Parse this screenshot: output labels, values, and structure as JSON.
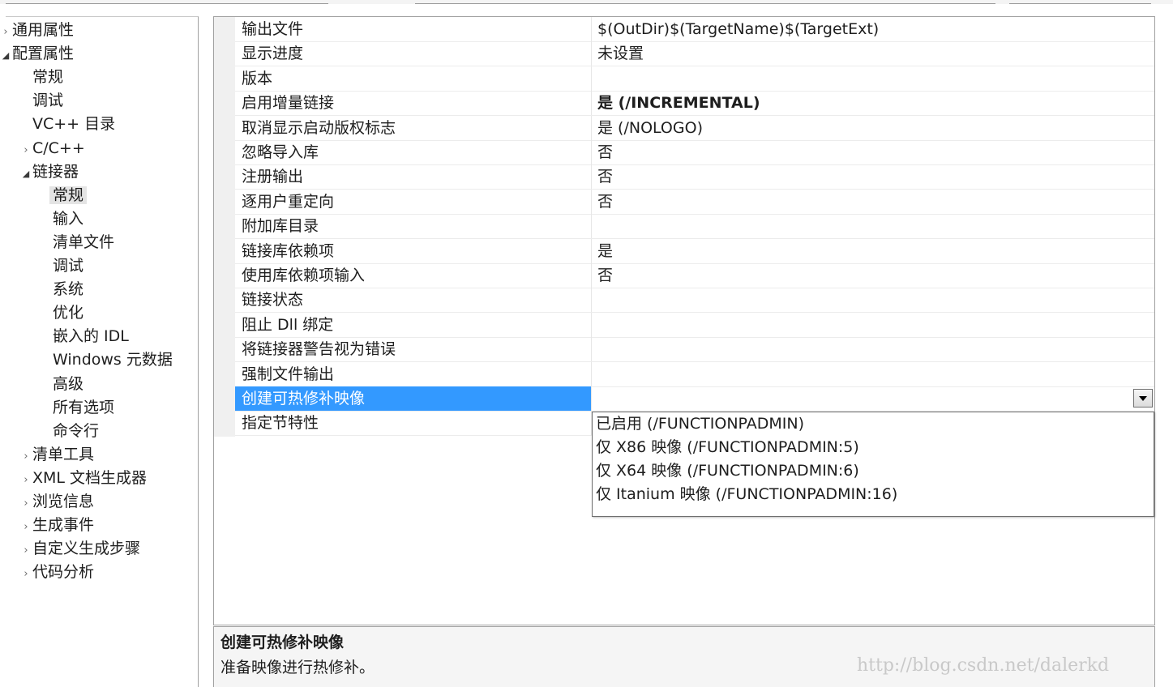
{
  "tree": {
    "items": [
      {
        "label": "通用属性",
        "arrow": "›",
        "level": 0
      },
      {
        "label": "配置属性",
        "arrow": "◢",
        "level": 0
      },
      {
        "label": "常规",
        "arrow": "",
        "level": 1
      },
      {
        "label": "调试",
        "arrow": "",
        "level": 1
      },
      {
        "label": "VC++ 目录",
        "arrow": "",
        "level": 1
      },
      {
        "label": "C/C++",
        "arrow": "›",
        "level": 1
      },
      {
        "label": "链接器",
        "arrow": "◢",
        "level": 1
      },
      {
        "label": "常规",
        "arrow": "",
        "level": 2
      },
      {
        "label": "输入",
        "arrow": "",
        "level": 2
      },
      {
        "label": "清单文件",
        "arrow": "",
        "level": 2
      },
      {
        "label": "调试",
        "arrow": "",
        "level": 2
      },
      {
        "label": "系统",
        "arrow": "",
        "level": 2
      },
      {
        "label": "优化",
        "arrow": "",
        "level": 2
      },
      {
        "label": "嵌入的 IDL",
        "arrow": "",
        "level": 2
      },
      {
        "label": "Windows 元数据",
        "arrow": "",
        "level": 2
      },
      {
        "label": "高级",
        "arrow": "",
        "level": 2
      },
      {
        "label": "所有选项",
        "arrow": "",
        "level": 2
      },
      {
        "label": "命令行",
        "arrow": "",
        "level": 2
      },
      {
        "label": "清单工具",
        "arrow": "›",
        "level": 1
      },
      {
        "label": "XML 文档生成器",
        "arrow": "›",
        "level": 1
      },
      {
        "label": "浏览信息",
        "arrow": "›",
        "level": 1
      },
      {
        "label": "生成事件",
        "arrow": "›",
        "level": 1
      },
      {
        "label": "自定义生成步骤",
        "arrow": "›",
        "level": 1
      },
      {
        "label": "代码分析",
        "arrow": "›",
        "level": 1
      }
    ]
  },
  "grid": {
    "rows": [
      {
        "name": "输出文件",
        "value": "$(OutDir)$(TargetName)$(TargetExt)"
      },
      {
        "name": "显示进度",
        "value": "未设置"
      },
      {
        "name": "版本",
        "value": ""
      },
      {
        "name": "启用增量链接",
        "value": "是 (/INCREMENTAL)",
        "bold": true
      },
      {
        "name": "取消显示启动版权标志",
        "value": "是 (/NOLOGO)"
      },
      {
        "name": "忽略导入库",
        "value": "否"
      },
      {
        "name": "注册输出",
        "value": "否"
      },
      {
        "name": "逐用户重定向",
        "value": "否"
      },
      {
        "name": "附加库目录",
        "value": ""
      },
      {
        "name": "链接库依赖项",
        "value": "是"
      },
      {
        "name": "使用库依赖项输入",
        "value": "否"
      },
      {
        "name": "链接状态",
        "value": ""
      },
      {
        "name": "阻止 Dll 绑定",
        "value": ""
      },
      {
        "name": "将链接器警告视为错误",
        "value": ""
      },
      {
        "name": "强制文件输出",
        "value": ""
      },
      {
        "name": "创建可热修补映像",
        "value": "",
        "selected": true
      },
      {
        "name": "指定节特性",
        "value": ""
      }
    ]
  },
  "dropdown": {
    "options": [
      "已启用 (/FUNCTIONPADMIN)",
      "仅 X86 映像 (/FUNCTIONPADMIN:5)",
      "仅 X64 映像 (/FUNCTIONPADMIN:6)",
      "仅 Itanium 映像 (/FUNCTIONPADMIN:16)"
    ]
  },
  "description": {
    "title": "创建可热修补映像",
    "text": "准备映像进行热修补。"
  },
  "watermark": "http://blog.csdn.net/dalerkd",
  "colors": {
    "selection": "#3399ff",
    "tree_selection": "#e4e4e4"
  }
}
